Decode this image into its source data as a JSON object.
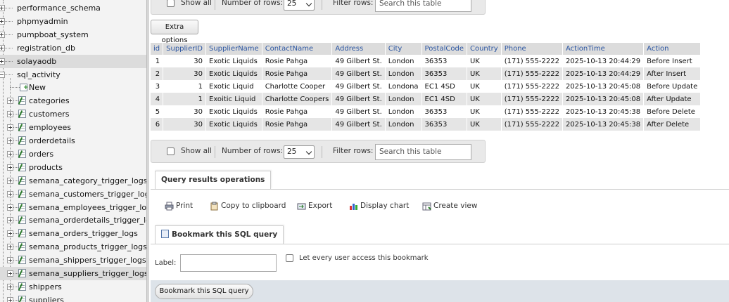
{
  "sidebar": {
    "databases": [
      {
        "label": "performance_schema",
        "expanded": false
      },
      {
        "label": "phpmyadmin",
        "expanded": false
      },
      {
        "label": "pumpboat_system",
        "expanded": false
      },
      {
        "label": "registration_db",
        "expanded": false
      },
      {
        "label": "solayaodb",
        "expanded": false
      },
      {
        "label": "sql_activity",
        "expanded": true
      }
    ],
    "new_item": "New",
    "tables": [
      "categories",
      "customers",
      "employees",
      "orderdetails",
      "orders",
      "products",
      "semana_category_trigger_logs",
      "semana_customers_trigger_logs",
      "semana_employees_trigger_logs",
      "semana_orderdetails_trigger_logs",
      "semana_orders_trigger_logs",
      "semana_products_trigger_logs",
      "semana_shippers_trigger_logs",
      "semana_suppliers_trigger_logs",
      "shippers",
      "suppliers"
    ]
  },
  "nav": {
    "show_all": "Show all",
    "number_of_rows_label": "Number of rows:",
    "rows_value": "25",
    "filter_label": "Filter rows:",
    "filter_placeholder": "Search this table"
  },
  "extra_options": "Extra options",
  "table": {
    "columns": [
      "id",
      "SupplierID",
      "SupplierName",
      "ContactName",
      "Address",
      "City",
      "PostalCode",
      "Country",
      "Phone",
      "ActionTime",
      "Action"
    ],
    "rows": [
      [
        "1",
        "30",
        "Exotic Liquids",
        "Rosie Pahga",
        "49 Gilbert St.",
        "London",
        "36353",
        "UK",
        "(171) 555-2222",
        "2025-10-13 20:44:29",
        "Before Insert"
      ],
      [
        "2",
        "30",
        "Exotic Liquids",
        "Rosie Pahga",
        "49 Gilbert St.",
        "London",
        "36353",
        "UK",
        "(171) 555-2222",
        "2025-10-13 20:44:29",
        "After Insert"
      ],
      [
        "3",
        "1",
        "Exotic Liquid",
        "Charlotte Cooper",
        "49 Gilbert St.",
        "Londona",
        "EC1 4SD",
        "UK",
        "(171) 555-2222",
        "2025-10-13 20:45:08",
        "Before Update"
      ],
      [
        "4",
        "1",
        "Exoitic Liquid",
        "Charlotte Coopers",
        "49 Gilbert St.",
        "London",
        "EC1 4SD",
        "UK",
        "(171) 555-2222",
        "2025-10-13 20:45:08",
        "After Update"
      ],
      [
        "5",
        "30",
        "Exotic Liquids",
        "Rosie Pahga",
        "49 Gilbert St.",
        "London",
        "36353",
        "UK",
        "(171) 555-2222",
        "2025-10-13 20:45:38",
        "Before Delete"
      ],
      [
        "6",
        "30",
        "Exotic Liquids",
        "Rosie Pahga",
        "49 Gilbert St.",
        "London",
        "36353",
        "UK",
        "(171) 555-2222",
        "2025-10-13 20:45:38",
        "After Delete"
      ]
    ]
  },
  "query_ops": {
    "title": "Query results operations",
    "print": "Print",
    "copy": "Copy to clipboard",
    "export": "Export",
    "chart": "Display chart",
    "create_view": "Create view"
  },
  "bookmark": {
    "title": "Bookmark this SQL query",
    "label": "Label:",
    "every_user": "Let every user access this bookmark",
    "button": "Bookmark this SQL query"
  }
}
